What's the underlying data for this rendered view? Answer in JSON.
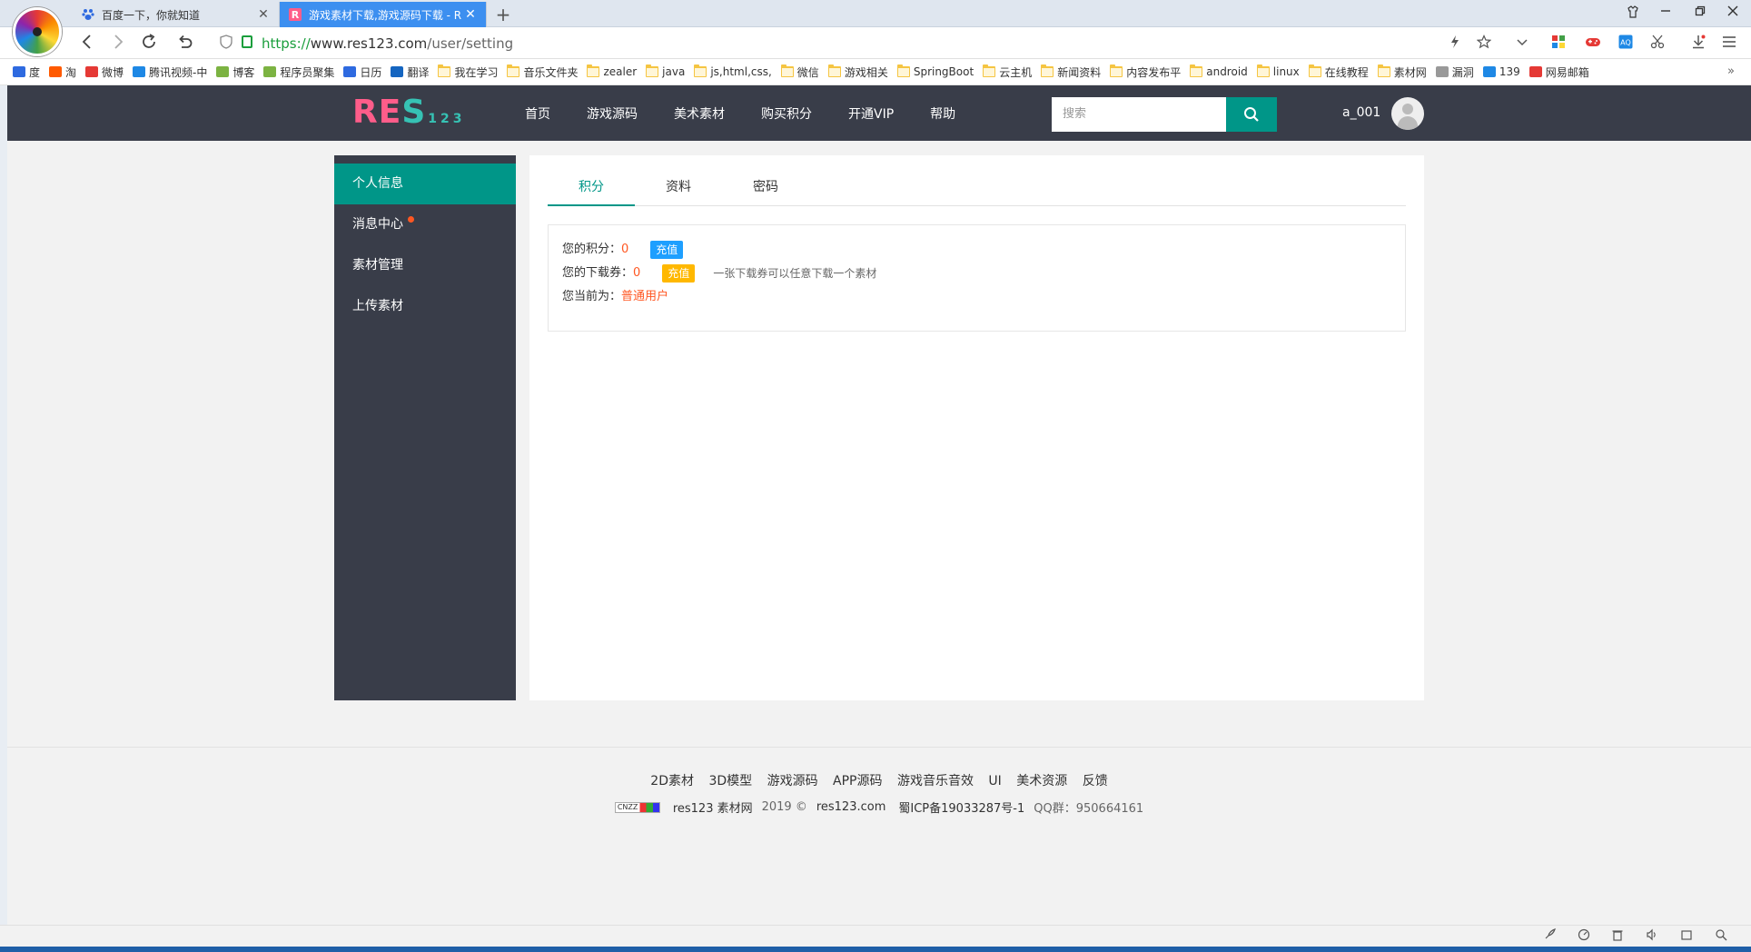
{
  "browser": {
    "tabs": [
      {
        "title": "百度一下，你就知道",
        "active": false,
        "close": "✕"
      },
      {
        "title": "游戏素材下载,游戏源码下载 - R",
        "active": true,
        "close": "✕"
      }
    ],
    "new_tab": "+",
    "address": {
      "scheme": "https://",
      "host": "www.res123.com",
      "path": "/user/setting"
    },
    "bookmarks": [
      "度",
      "淘",
      "微博",
      "腾讯视频-中",
      "博客",
      "程序员聚集",
      "日历",
      "翻译",
      "我在学习",
      "音乐文件夹",
      "zealer",
      "java",
      "js,html,css,",
      "微信",
      "游戏相关",
      "SpringBoot",
      "云主机",
      "新闻资料",
      "内容发布平",
      "android",
      "linux",
      "在线教程",
      "素材网",
      "漏洞",
      "139",
      "网易邮箱"
    ],
    "bookmark_more": "»"
  },
  "site": {
    "logo": {
      "r": "R",
      "e": "E",
      "s": "S",
      "n": "123"
    },
    "nav": [
      "首页",
      "游戏源码",
      "美术素材",
      "购买积分",
      "开通VIP",
      "帮助"
    ],
    "search_placeholder": "搜索",
    "username": "a_001"
  },
  "sidebar": {
    "items": [
      {
        "label": "个人信息",
        "active": true
      },
      {
        "label": "消息中心",
        "dot": true
      },
      {
        "label": "素材管理"
      },
      {
        "label": "上传素材"
      }
    ]
  },
  "panel": {
    "tabs": [
      {
        "label": "积分",
        "active": true
      },
      {
        "label": "资料"
      },
      {
        "label": "密码"
      }
    ],
    "points_label": "您的积分：",
    "points_value": "0",
    "recharge": "充值",
    "coupon_label": "您的下载券：",
    "coupon_value": "0",
    "coupon_hint": "一张下载券可以任意下载一个素材",
    "level_label": "您当前为：",
    "level_value": "普通用户"
  },
  "footer": {
    "links": [
      "2D素材",
      "3D模型",
      "游戏源码",
      "APP源码",
      "游戏音乐音效",
      "UI",
      "美术资源",
      "反馈"
    ],
    "cnzz": "CNZZ",
    "site_name": "res123 素材网",
    "year": "2019 ©",
    "domain": "res123.com",
    "icp": "蜀ICP备19033287号-1",
    "qq": "QQ群：950664161"
  },
  "colors": {
    "header_bg": "#393d49",
    "accent": "#009688",
    "alert": "#ff5722",
    "blue_badge": "#1e9fff",
    "orange_badge": "#ffb800",
    "tab_active": "#3c8ff0"
  }
}
